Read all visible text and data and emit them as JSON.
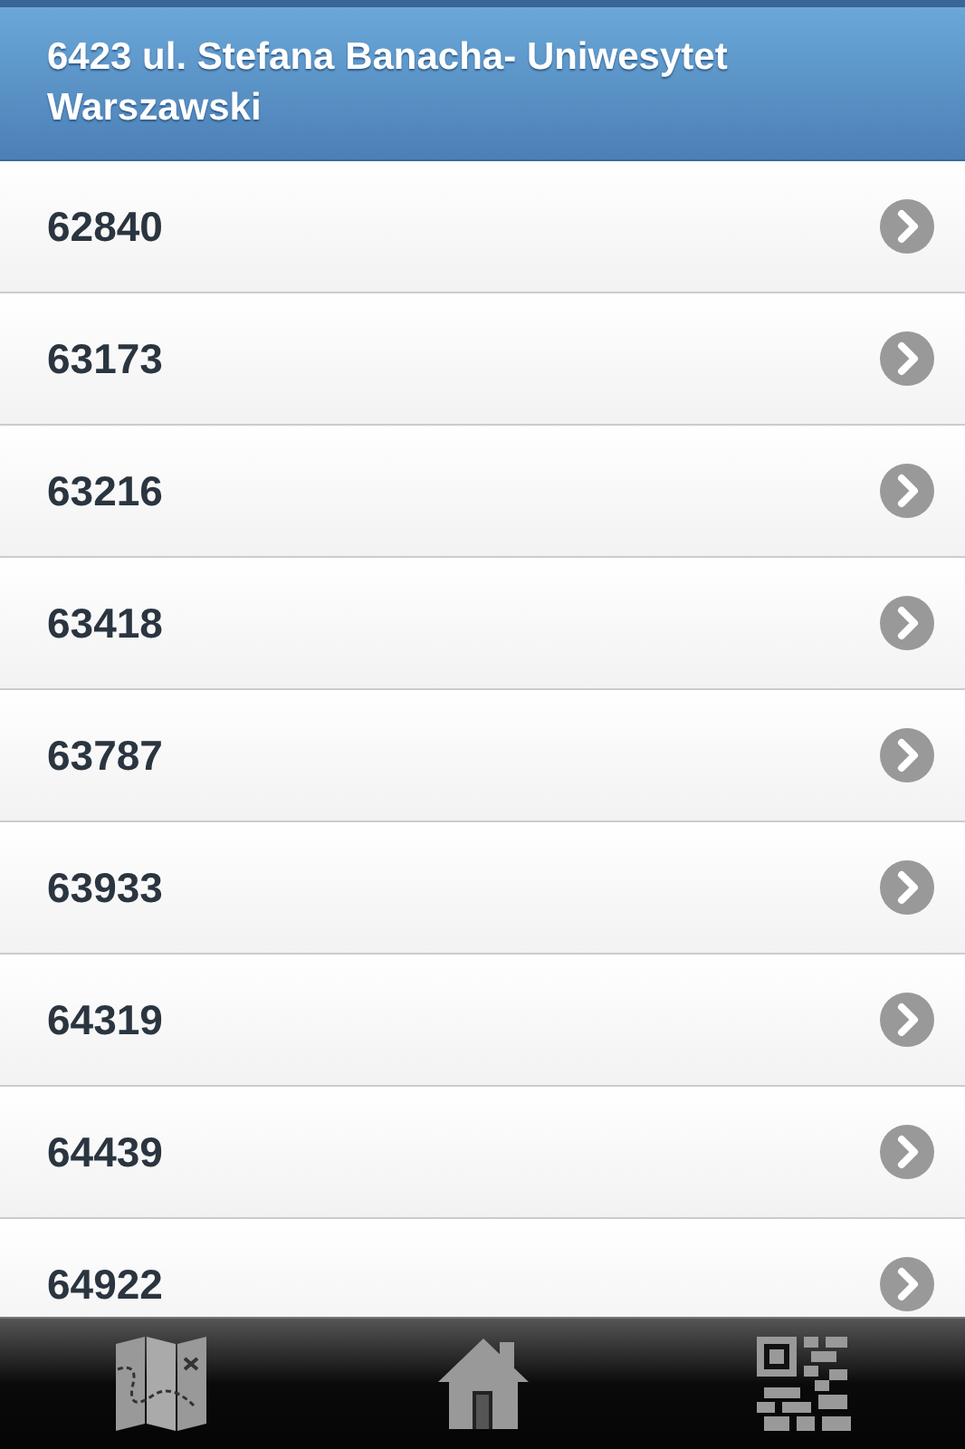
{
  "header": {
    "title": "6423 ul. Stefana Banacha- Uniwesytet Warszawski"
  },
  "rows": [
    {
      "label": "62840"
    },
    {
      "label": "63173"
    },
    {
      "label": "63216"
    },
    {
      "label": "63418"
    },
    {
      "label": "63787"
    },
    {
      "label": "63933"
    },
    {
      "label": "64319"
    },
    {
      "label": "64439"
    },
    {
      "label": "64922"
    }
  ]
}
